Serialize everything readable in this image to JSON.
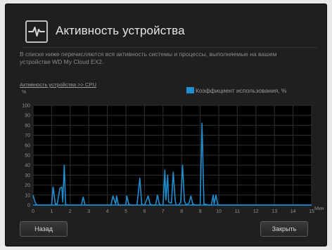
{
  "dialog": {
    "title": "Активность устройства",
    "description": "В списке ниже перечисляются вся активность системы и процессы, выполняемые на вашем устройстве WD My Cloud EX2.",
    "cpu_link": "Активность устройства >> CPU",
    "y_unit": "%",
    "back_label": "Назад",
    "close_label": "Закрыть",
    "accent_color": "#1f8fd0",
    "header_icon": "activity-pulse-icon"
  },
  "chart_data": {
    "type": "line",
    "legend": "Коэффициент использования, %",
    "legend_position": "top-right",
    "xlabel": "Мин",
    "ylabel": "%",
    "xlim": [
      0,
      15
    ],
    "ylim": [
      0,
      100
    ],
    "xticks": [
      0,
      1,
      2,
      3,
      4,
      5,
      6,
      7,
      8,
      9,
      10,
      11,
      12,
      13,
      14,
      15
    ],
    "yticks": [
      0,
      10,
      20,
      30,
      40,
      50,
      60,
      70,
      80,
      90,
      100
    ],
    "grid": true,
    "series": [
      {
        "name": "Коэффициент использования, %",
        "color": "#1f8fd0",
        "x": [
          0.0,
          0.12,
          0.22,
          0.5,
          1.0,
          1.08,
          1.2,
          1.3,
          1.45,
          1.55,
          1.6,
          1.68,
          1.75,
          1.85,
          2.0,
          2.6,
          2.7,
          2.8,
          4.0,
          4.2,
          4.3,
          4.45,
          4.5,
          4.6,
          5.0,
          5.05,
          5.15,
          5.25,
          5.6,
          5.75,
          5.85,
          5.95,
          6.0,
          6.2,
          6.3,
          6.4,
          6.6,
          6.7,
          6.8,
          6.9,
          7.0,
          7.1,
          7.15,
          7.25,
          7.3,
          7.45,
          7.55,
          7.65,
          7.7,
          7.85,
          7.95,
          8.05,
          8.15,
          8.25,
          8.4,
          8.5,
          8.6,
          8.75,
          8.85,
          9.0,
          9.1,
          9.2,
          9.5,
          9.6,
          9.7,
          9.75,
          9.85,
          9.95,
          10.1,
          10.2,
          15.0
        ],
        "y": [
          10,
          2,
          0,
          0,
          0,
          18,
          1,
          1,
          17,
          18,
          3,
          40,
          1,
          0,
          0,
          0,
          8,
          0,
          0,
          0,
          9,
          1,
          9,
          0,
          0,
          9,
          1,
          0,
          0,
          27,
          1,
          0,
          0,
          9,
          1,
          0,
          0,
          10,
          1,
          0,
          0,
          35,
          5,
          30,
          3,
          2,
          33,
          5,
          0,
          0,
          3,
          40,
          4,
          0,
          2,
          9,
          1,
          0,
          0,
          0,
          82,
          1,
          0,
          0,
          10,
          1,
          10,
          0,
          0,
          0,
          0
        ]
      }
    ]
  }
}
